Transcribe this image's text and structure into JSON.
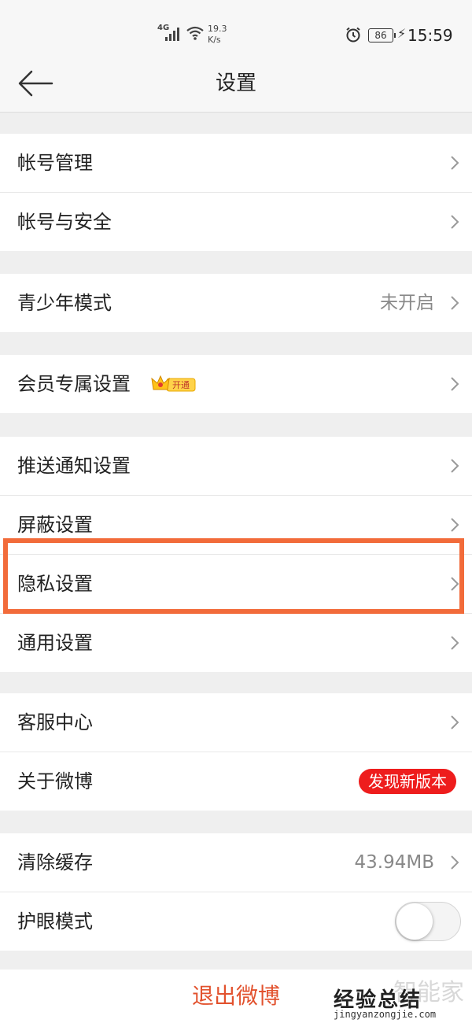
{
  "status_bar": {
    "network": "4G",
    "speed_value": "19.3",
    "speed_unit": "K/s",
    "battery": "86",
    "time": "15:59"
  },
  "nav": {
    "title": "设置",
    "back_icon": "back-arrow-icon"
  },
  "groups": [
    {
      "items": [
        {
          "label": "帐号管理"
        },
        {
          "label": "帐号与安全"
        }
      ]
    },
    {
      "items": [
        {
          "label": "青少年模式",
          "value": "未开启"
        }
      ]
    },
    {
      "items": [
        {
          "label": "会员专属设置",
          "badge": "开通"
        }
      ]
    },
    {
      "items": [
        {
          "label": "推送通知设置"
        },
        {
          "label": "屏蔽设置"
        },
        {
          "label": "隐私设置",
          "highlighted": true
        },
        {
          "label": "通用设置"
        }
      ]
    },
    {
      "items": [
        {
          "label": "客服中心"
        },
        {
          "label": "关于微博",
          "badge": "发现新版本"
        }
      ]
    },
    {
      "items": [
        {
          "label": "清除缓存",
          "value": "43.94MB"
        },
        {
          "label": "护眼模式",
          "toggle": false
        }
      ]
    }
  ],
  "logout": {
    "label": "退出微博"
  },
  "watermark": {
    "big": "智能家",
    "main": "经验总结",
    "url": "jingyanzongjie.com"
  },
  "colors": {
    "accent": "#e2522e",
    "highlight_border": "#f26b3a",
    "badge_red": "#ee1d1d",
    "background": "#efefef"
  }
}
